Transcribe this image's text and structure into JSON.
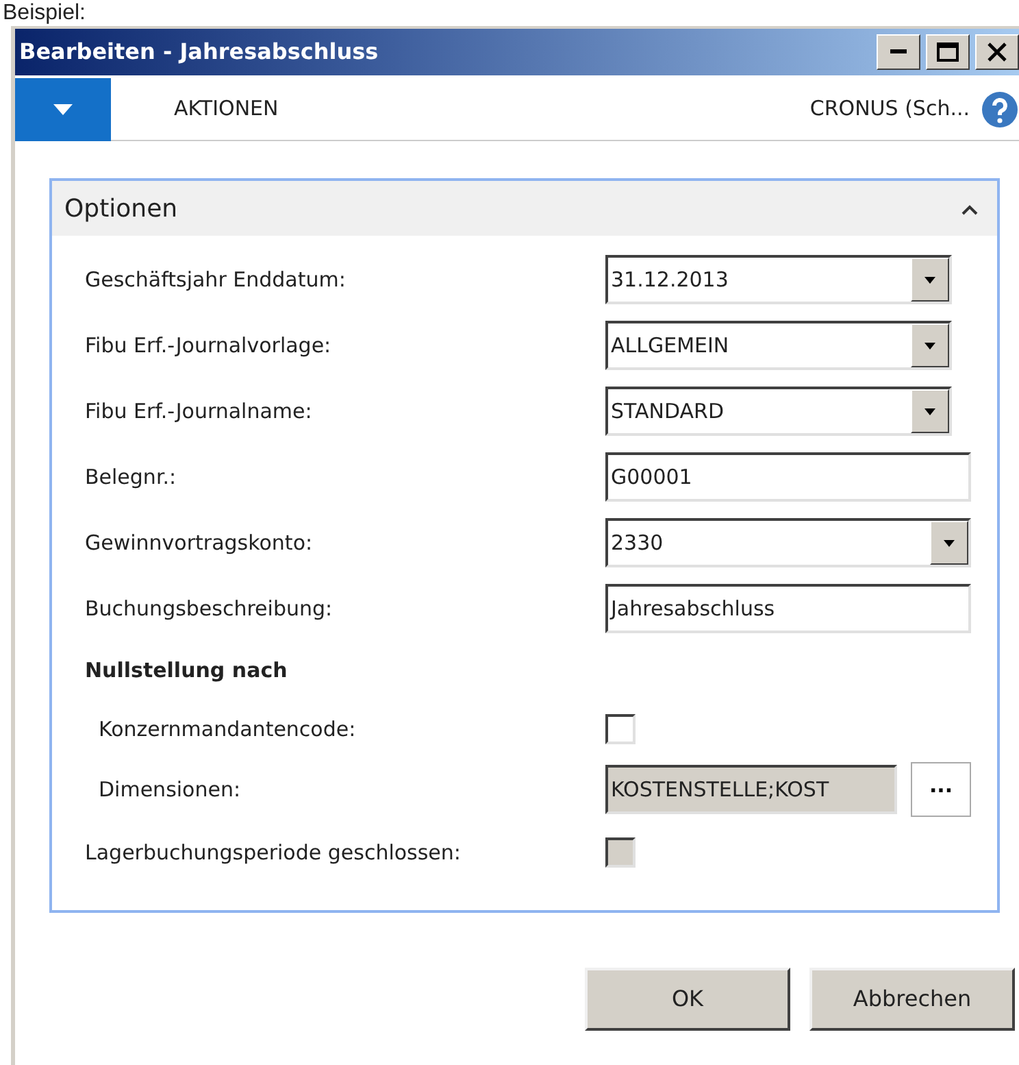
{
  "caption": "Beispiel:",
  "window": {
    "title": "Bearbeiten - Jahresabschluss"
  },
  "ribbon": {
    "tab": "AKTIONEN",
    "company": "CRONUS (Sch..."
  },
  "panel": {
    "title": "Optionen",
    "expanded": true,
    "fields": [
      {
        "kind": "dropdown",
        "label": "Geschäftsjahr Enddatum:",
        "value": "31.12.2013"
      },
      {
        "kind": "dropdown",
        "label": "Fibu Erf.-Journalvorlage:",
        "value": "ALLGEMEIN"
      },
      {
        "kind": "dropdown",
        "label": "Fibu Erf.-Journalname:",
        "value": "STANDARD"
      },
      {
        "kind": "text",
        "label": "Belegnr.:",
        "value": "G00001"
      },
      {
        "kind": "dropdown-wide",
        "label": "Gewinnvortragskonto:",
        "value": "2330"
      },
      {
        "kind": "text",
        "label": "Buchungsbeschreibung:",
        "value": "Jahresabschluss"
      },
      {
        "kind": "heading",
        "label": "Nullstellung nach"
      },
      {
        "kind": "checkbox",
        "label": "Konzernmandantencode:",
        "checked": false,
        "disabled": false,
        "indent": true
      },
      {
        "kind": "lookup",
        "label": "Dimensionen:",
        "value": "KOSTENSTELLE;KOST",
        "button": "...",
        "indent": true
      },
      {
        "kind": "checkbox",
        "label": "Lagerbuchungsperiode geschlossen:",
        "checked": false,
        "disabled": true,
        "indent": false
      }
    ]
  },
  "buttons": [
    "OK",
    "Abbrechen"
  ]
}
